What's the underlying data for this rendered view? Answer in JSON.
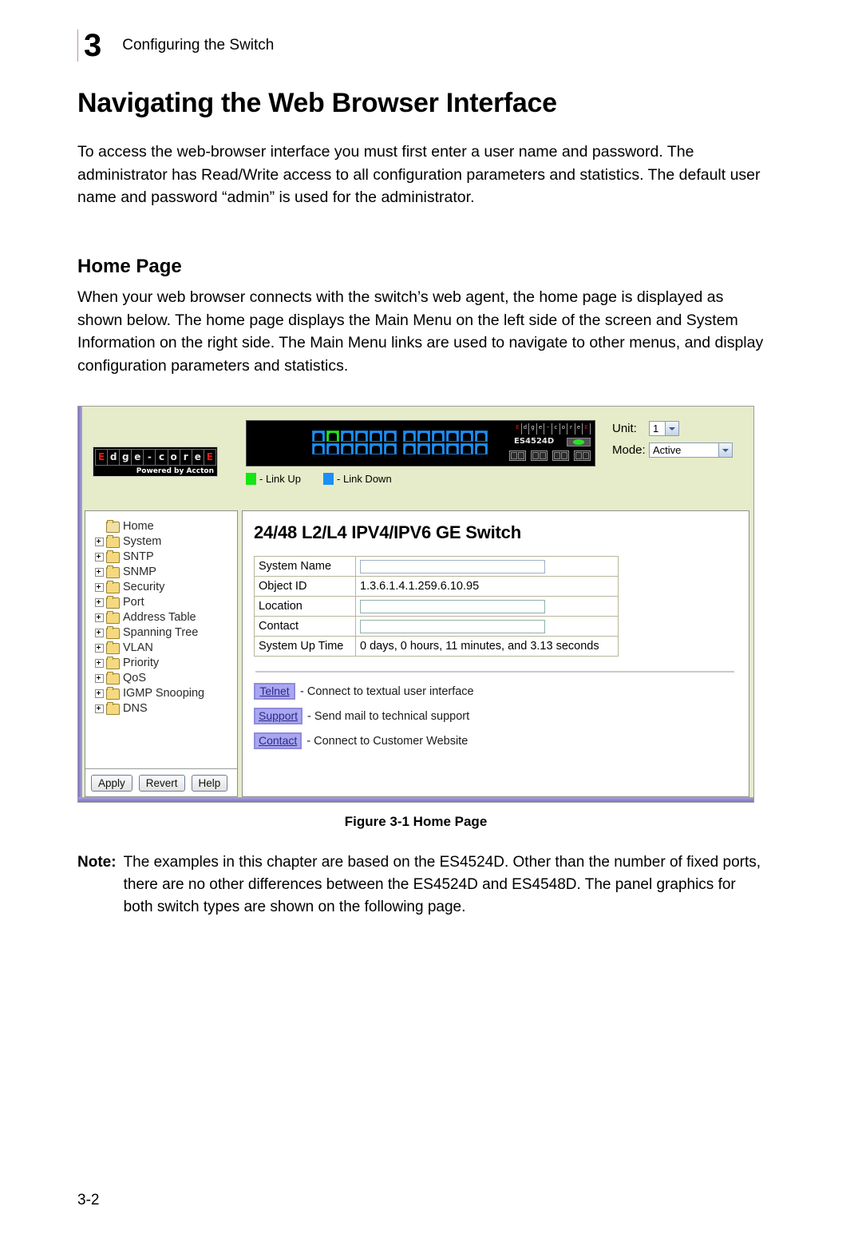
{
  "header": {
    "chapter_number": "3",
    "chapter_title": "Configuring the Switch"
  },
  "doc": {
    "title": "Navigating the Web Browser Interface",
    "intro_paragraph": "To access the web-browser interface you must first enter a user name and password. The administrator has Read/Write access to all configuration parameters and statistics. The default user name and password “admin” is used for the administrator.",
    "section_title": "Home Page",
    "section_paragraph": "When your web browser connects with the switch’s web agent, the home page is displayed as shown below. The home page displays the Main Menu on the left side of the screen and System Information on the right side. The Main Menu links are used to navigate to other menus, and display configuration parameters and statistics.",
    "figure_caption": "Figure 3-1  Home Page",
    "note_label": "Note:",
    "note_text": "The examples in this chapter are based on the ES4524D. Other than the number of fixed ports, there are no other differences between the ES4524D and ES4548D. The panel graphics for both switch types are shown on the following page.",
    "page_number": "3-2"
  },
  "figure": {
    "banner": {
      "logo_letters": [
        "E",
        "d",
        "g",
        "e",
        "-",
        "c",
        "o",
        "r",
        "e",
        "E"
      ],
      "logo_tagline": "Powered by Accton",
      "switch_model": "ES4524D",
      "port_rows": 2,
      "port_columns": 12,
      "link_up_port_index": 1,
      "sfp_slots": 4,
      "legend": [
        {
          "color": "#15e615",
          "label": "- Link Up"
        },
        {
          "color": "#1c8ef5",
          "label": "- Link Down"
        }
      ],
      "controls": [
        {
          "label": "Unit:",
          "value": "1"
        },
        {
          "label": "Mode:",
          "value": "Active"
        }
      ]
    },
    "tree": {
      "items": [
        {
          "label": "Home",
          "expandable": false,
          "selected": true
        },
        {
          "label": "System",
          "expandable": true
        },
        {
          "label": "SNTP",
          "expandable": true
        },
        {
          "label": "SNMP",
          "expandable": true
        },
        {
          "label": "Security",
          "expandable": true
        },
        {
          "label": "Port",
          "expandable": true
        },
        {
          "label": "Address Table",
          "expandable": true
        },
        {
          "label": "Spanning Tree",
          "expandable": true
        },
        {
          "label": "VLAN",
          "expandable": true
        },
        {
          "label": "Priority",
          "expandable": true
        },
        {
          "label": "QoS",
          "expandable": true
        },
        {
          "label": "IGMP Snooping",
          "expandable": true
        },
        {
          "label": "DNS",
          "expandable": true
        }
      ],
      "actions": [
        "Apply",
        "Revert",
        "Help"
      ]
    },
    "content": {
      "title": "24/48 L2/L4 IPV4/IPV6 GE Switch",
      "table": [
        {
          "key": "System Name",
          "value": "",
          "type": "input"
        },
        {
          "key": "Object ID",
          "value": "1.3.6.1.4.1.259.6.10.95",
          "type": "text"
        },
        {
          "key": "Location",
          "value": "",
          "type": "input"
        },
        {
          "key": "Contact",
          "value": "",
          "type": "input"
        },
        {
          "key": "System Up Time",
          "value": "0 days, 0 hours, 11 minutes, and 3.13 seconds",
          "type": "text"
        }
      ],
      "links": [
        {
          "button": "Telnet",
          "description": "- Connect to textual user interface"
        },
        {
          "button": "Support",
          "description": "- Send mail to technical support"
        },
        {
          "button": "Contact",
          "description": "- Connect to Customer Website"
        }
      ]
    }
  }
}
